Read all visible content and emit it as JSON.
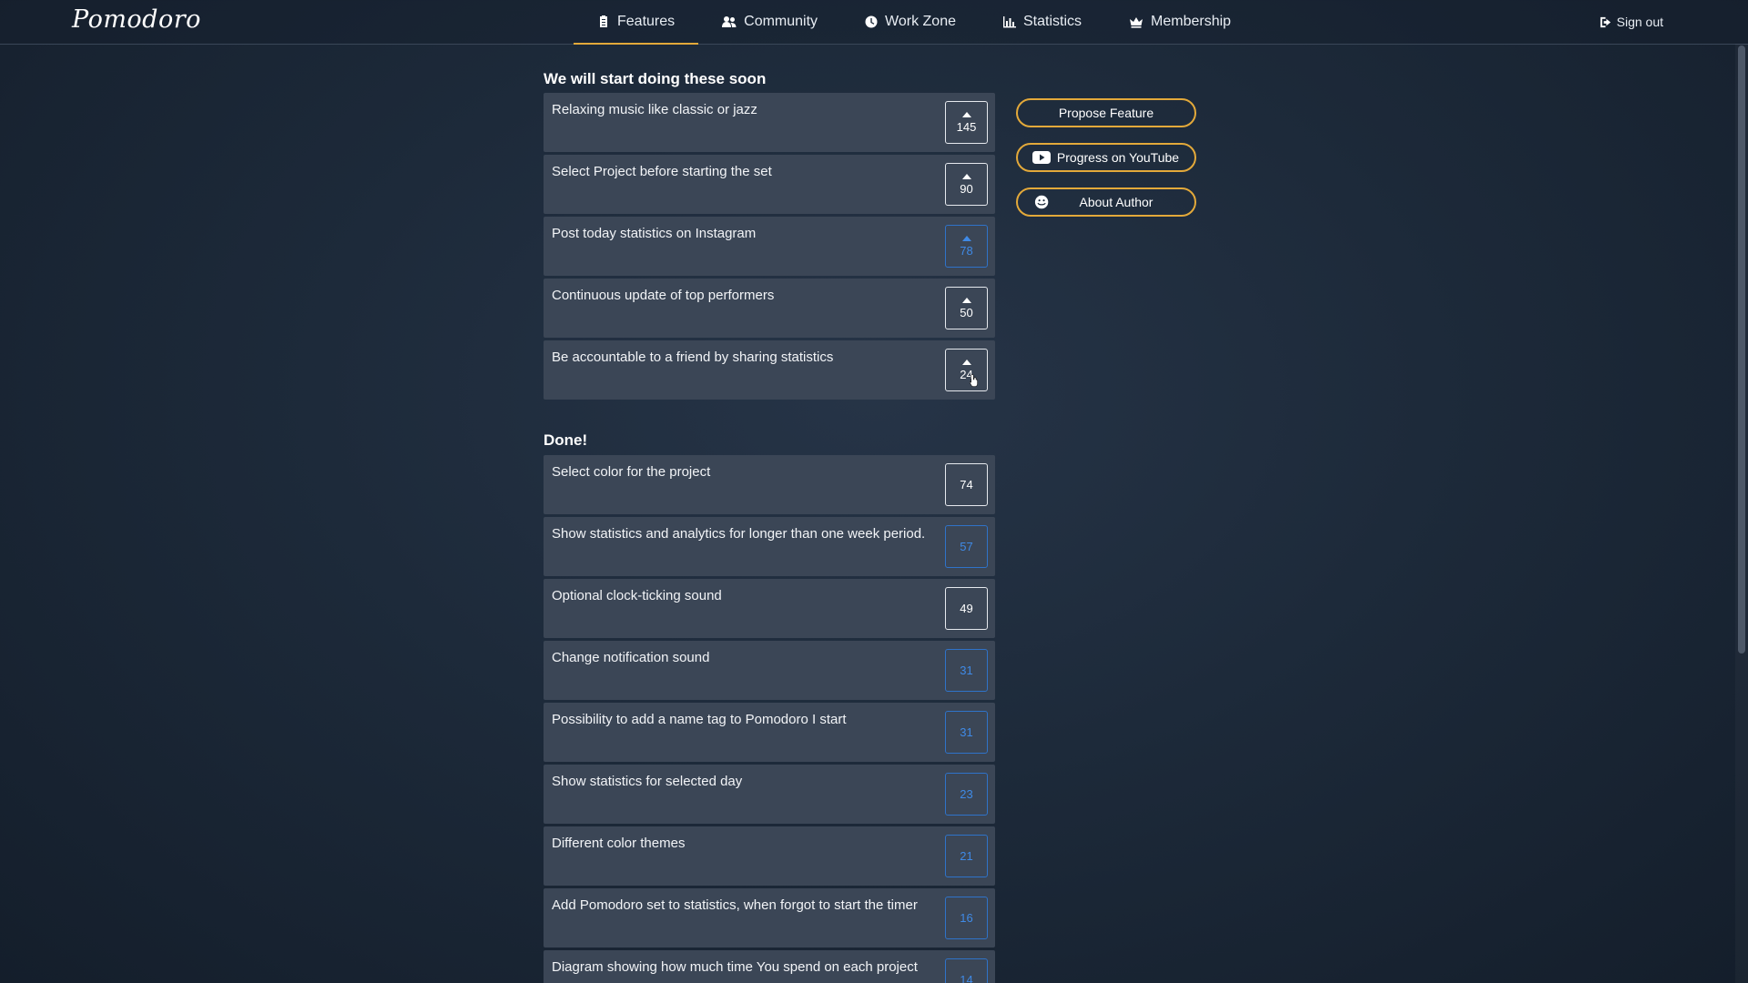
{
  "app": {
    "logo": "Pomodoro"
  },
  "nav": {
    "items": [
      {
        "label": "Features",
        "icon": "clipboard-icon",
        "active": true
      },
      {
        "label": "Community",
        "icon": "users-icon"
      },
      {
        "label": "Work Zone",
        "icon": "clock-icon"
      },
      {
        "label": "Statistics",
        "icon": "bar-chart-icon"
      },
      {
        "label": "Membership",
        "icon": "crown-icon"
      }
    ],
    "sign_out": "Sign out"
  },
  "soon": {
    "title": "We will start doing these soon",
    "items": [
      {
        "text": "Relaxing music like classic or jazz",
        "votes": "145",
        "voted": false
      },
      {
        "text": "Select Project before starting the set",
        "votes": "90",
        "voted": false
      },
      {
        "text": "Post today statistics on Instagram",
        "votes": "78",
        "voted": true
      },
      {
        "text": "Continuous update of top performers",
        "votes": "50",
        "voted": false
      },
      {
        "text": "Be accountable to a friend by sharing statistics",
        "votes": "24",
        "voted": false
      }
    ]
  },
  "done": {
    "title": "Done!",
    "items": [
      {
        "text": "Select color for the project",
        "votes": "74",
        "voted": false
      },
      {
        "text": "Show statistics and analytics for longer than one week period.",
        "votes": "57",
        "voted": true
      },
      {
        "text": "Optional clock-ticking sound",
        "votes": "49",
        "voted": false
      },
      {
        "text": "Change notification sound",
        "votes": "31",
        "voted": true
      },
      {
        "text": "Possibility to add a name tag to Pomodoro I start",
        "votes": "31",
        "voted": true
      },
      {
        "text": "Show statistics for selected day",
        "votes": "23",
        "voted": true
      },
      {
        "text": "Different color themes",
        "votes": "21",
        "voted": true
      },
      {
        "text": "Add Pomodoro set to statistics, when forgot to start the timer",
        "votes": "16",
        "voted": true
      },
      {
        "text": "Diagram showing how much time You spend on each project",
        "votes": "14",
        "voted": true
      }
    ]
  },
  "side": {
    "propose": "Propose Feature",
    "youtube": "Progress on YouTube",
    "author": "About Author"
  },
  "colors": {
    "accent": "#e3a93a",
    "voted": "#3f8ae6",
    "row": "#3b4656"
  }
}
